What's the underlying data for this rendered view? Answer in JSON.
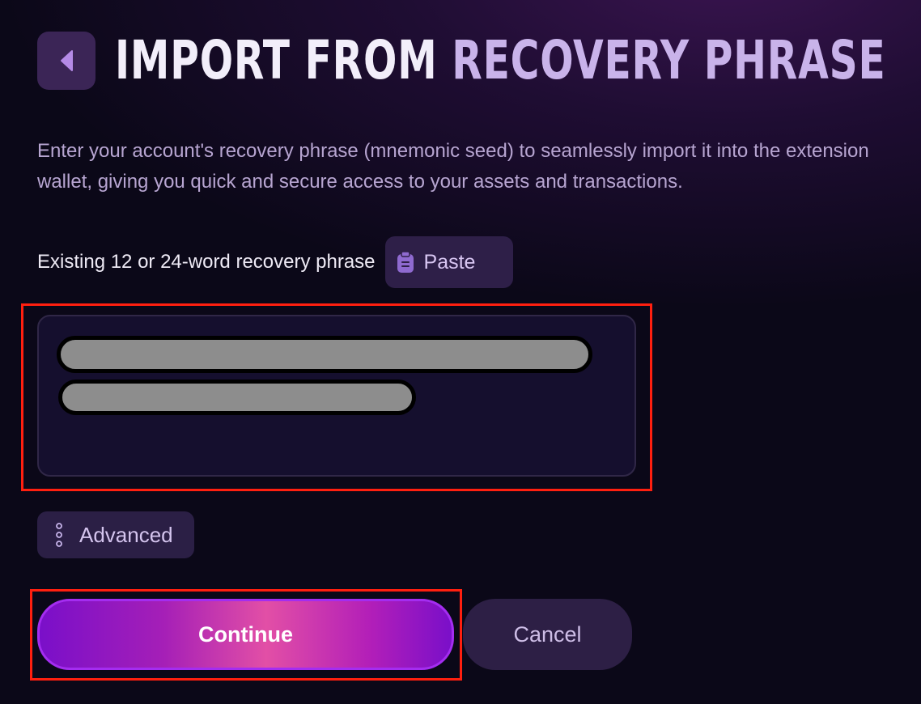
{
  "header": {
    "back_icon": "chevron-left-icon",
    "title_part1": "IMPORT FROM ",
    "title_part2": "RECOVERY PHRASE"
  },
  "description": "Enter your account's recovery phrase (mnemonic seed) to seamlessly import it into the extension wallet, giving you quick and secure access to your assets and transactions.",
  "phrase": {
    "label": "Existing 12 or 24-word recovery phrase",
    "paste_label": "Paste",
    "paste_icon": "clipboard-icon"
  },
  "advanced": {
    "label": "Advanced",
    "icon": "vertical-dots-icon"
  },
  "actions": {
    "continue_label": "Continue",
    "cancel_label": "Cancel"
  },
  "colors": {
    "accent_purple": "#a42df0",
    "accent_pink": "#e24fa6",
    "title_accent": "#c9b3ea",
    "highlight_red": "#ff1f0f"
  }
}
